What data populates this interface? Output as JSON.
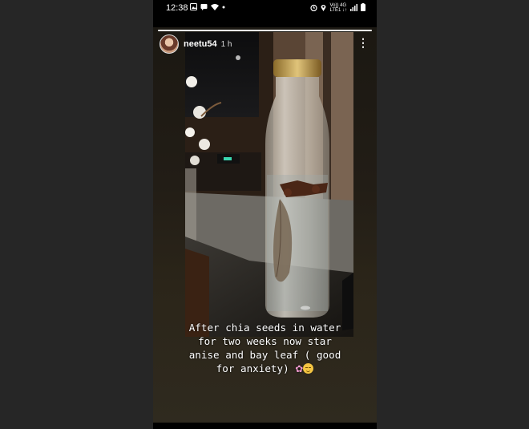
{
  "status_bar": {
    "time": "12:38",
    "left_icons": [
      "photo-notification-icon",
      "message-icon",
      "wifi-icon",
      "dot-icon"
    ],
    "right_icons": [
      "alarm-icon",
      "location-icon",
      "volte-icon",
      "signal-icon",
      "battery-icon"
    ],
    "volte_text": "Vo)) 4G",
    "lte_text": "LTE1 ↓↑"
  },
  "story": {
    "progress": 1.0,
    "username": "neetu54",
    "time_ago": "1 h",
    "caption_line1": "After chia seeds in water",
    "caption_line2": "for two weeks now star",
    "caption_line3": "anise and bay leaf ( good",
    "caption_line4": "for anxiety)",
    "emoji_flower": "🌸",
    "emoji_face": "😌"
  }
}
